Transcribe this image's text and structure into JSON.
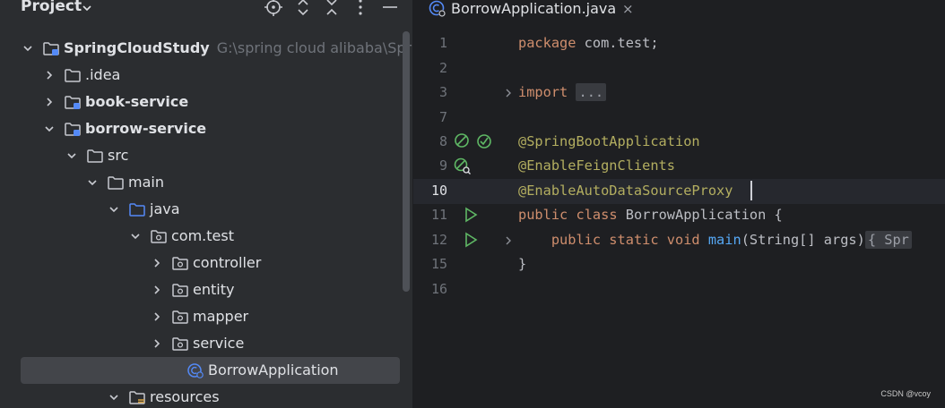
{
  "project_panel": {
    "title": "Project",
    "tree": [
      {
        "label": "SpringCloudStudy",
        "hint": "G:\\spring cloud alibaba\\Sprin",
        "bold": true,
        "expanded": true,
        "icon": "module-folder-icon"
      },
      {
        "label": ".idea",
        "bold": false,
        "expanded": false,
        "icon": "folder-icon"
      },
      {
        "label": "book-service",
        "bold": true,
        "expanded": false,
        "icon": "module-folder-icon"
      },
      {
        "label": "borrow-service",
        "bold": true,
        "expanded": true,
        "icon": "module-folder-icon"
      },
      {
        "label": "src",
        "bold": false,
        "expanded": true,
        "icon": "folder-icon"
      },
      {
        "label": "main",
        "bold": false,
        "expanded": true,
        "icon": "folder-icon"
      },
      {
        "label": "java",
        "bold": false,
        "expanded": true,
        "icon": "source-folder-icon"
      },
      {
        "label": "com.test",
        "bold": false,
        "expanded": true,
        "icon": "package-icon"
      },
      {
        "label": "controller",
        "bold": false,
        "expanded": false,
        "icon": "package-icon"
      },
      {
        "label": "entity",
        "bold": false,
        "expanded": false,
        "icon": "package-icon"
      },
      {
        "label": "mapper",
        "bold": false,
        "expanded": false,
        "icon": "package-icon"
      },
      {
        "label": "service",
        "bold": false,
        "expanded": false,
        "icon": "package-icon"
      },
      {
        "label": "BorrowApplication",
        "bold": false,
        "icon": "spring-class-icon",
        "selected": true
      },
      {
        "label": "resources",
        "bold": false,
        "expanded": true,
        "icon": "resources-folder-icon"
      }
    ]
  },
  "editor": {
    "tab": {
      "label": "BorrowApplication.java",
      "close": "×"
    },
    "lines": [
      {
        "num": "1"
      },
      {
        "num": "2"
      },
      {
        "num": "3"
      },
      {
        "num": "7"
      },
      {
        "num": "8"
      },
      {
        "num": "9"
      },
      {
        "num": "10"
      },
      {
        "num": "11"
      },
      {
        "num": "12"
      },
      {
        "num": "15"
      },
      {
        "num": "16"
      }
    ],
    "code": {
      "l1_kw": "package",
      "l1_rest": " com.test;",
      "l3_kw": "import",
      "l3_fold": "...",
      "l8": "@SpringBootApplication",
      "l9": "@EnableFeignClients",
      "l10": "@EnableAutoDataSourceProxy",
      "l11_kw1": "public",
      "l11_kw2": "class",
      "l11_rest": " BorrowApplication {",
      "l12_kw": "public static void",
      "l12_fn": "main",
      "l12_rest": "(String[] args)",
      "l12_fold": "{ Spr",
      "l15": "}"
    }
  },
  "watermark": "CSDN @vcoy"
}
